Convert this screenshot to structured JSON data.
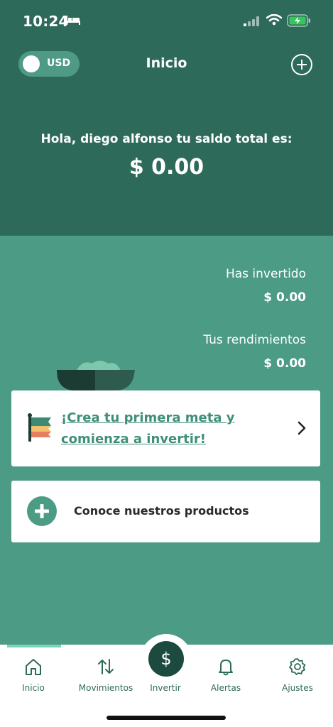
{
  "status_bar": {
    "time": "10:24",
    "icons": [
      "bed-icon",
      "cellular-signal-icon",
      "wifi-icon",
      "battery-charging-icon"
    ]
  },
  "header": {
    "currency": "USD",
    "title": "Inicio",
    "add_icon": "plus-circle-icon"
  },
  "balance": {
    "greeting": "Hola, diego alfonso tu saldo total es:",
    "total": "$ 0.00"
  },
  "stats": {
    "invested_label": "Has invertido",
    "invested_value": "$ 0.00",
    "returns_label": "Tus rendimientos",
    "returns_value": "$ 0.00"
  },
  "goal_card": {
    "text": "¡Crea tu primera meta y comienza a invertir!",
    "icon": "flag-icon"
  },
  "products_card": {
    "label": "Conoce nuestros productos",
    "icon": "plus-circle-icon"
  },
  "tab_bar": {
    "tabs": [
      {
        "label": "Inicio",
        "icon": "home-icon",
        "active": true
      },
      {
        "label": "Movimientos",
        "icon": "arrows-updown-icon"
      },
      {
        "label": "Invertir",
        "icon": "dollar-icon"
      },
      {
        "label": "Alertas",
        "icon": "bell-icon"
      },
      {
        "label": "Ajustes",
        "icon": "gear-icon"
      }
    ]
  },
  "colors": {
    "header_bg": "#2e6a5a",
    "body_bg": "#4c9b85",
    "accent": "#77d6b3",
    "invest_button": "#1d4a3e"
  }
}
